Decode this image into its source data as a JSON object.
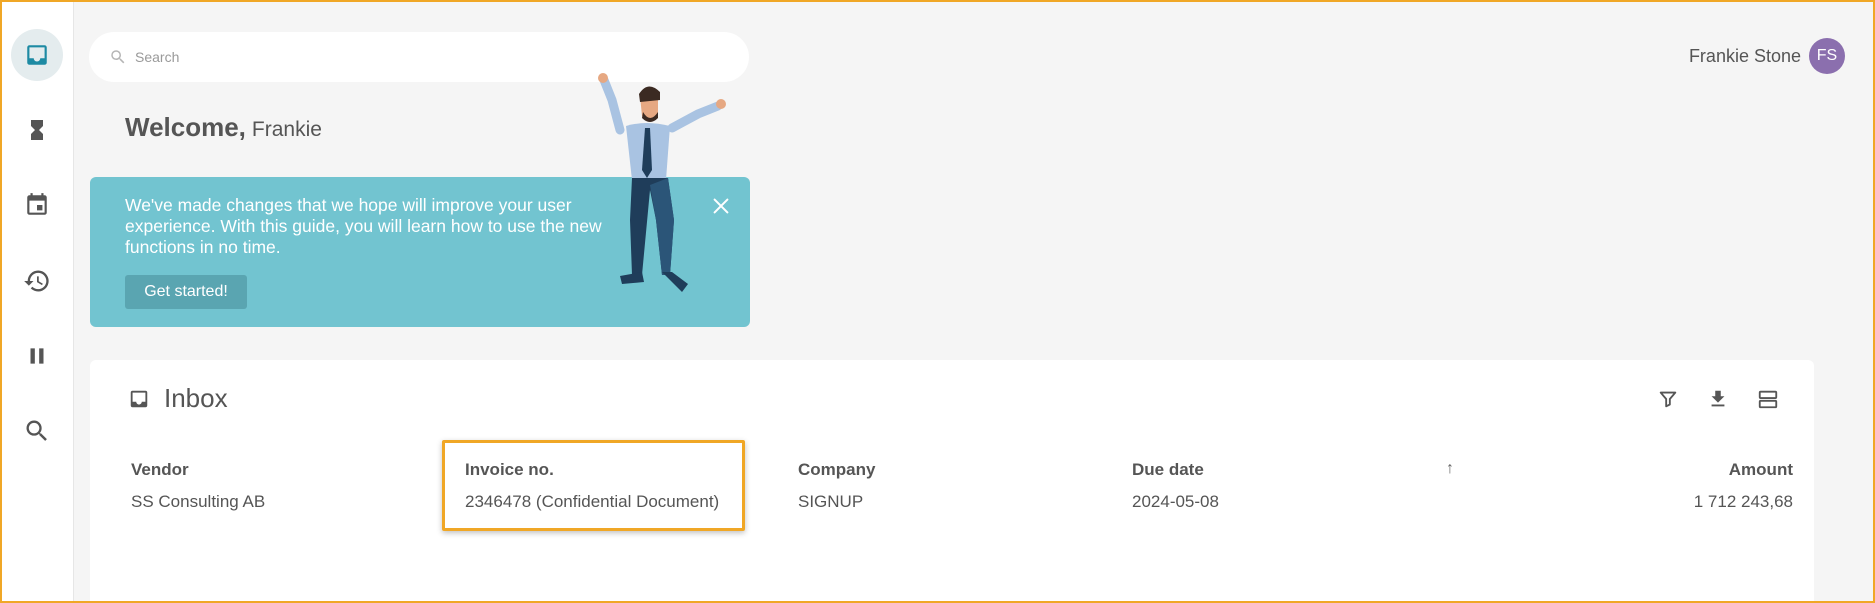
{
  "search": {
    "placeholder": "Search"
  },
  "user": {
    "name": "Frankie Stone",
    "initials": "FS",
    "avatar_color": "#8b6fae"
  },
  "welcome": {
    "greeting": "Welcome,",
    "name": "Frankie"
  },
  "banner": {
    "text": "We've made changes that we hope will improve your user experience. With this guide, you will learn how to use the new functions in no time.",
    "button_label": "Get started!",
    "background_color": "#72c4d0"
  },
  "sidebar": {
    "items": [
      {
        "icon": "inbox-icon",
        "active": true
      },
      {
        "icon": "hourglass-icon",
        "active": false
      },
      {
        "icon": "calendar-icon",
        "active": false
      },
      {
        "icon": "history-icon",
        "active": false
      },
      {
        "icon": "pause-icon",
        "active": false
      },
      {
        "icon": "search-icon",
        "active": false
      }
    ]
  },
  "inbox": {
    "title": "Inbox",
    "columns": [
      "Vendor",
      "Invoice no.",
      "Company",
      "Due date",
      "Amount"
    ],
    "sort_indicator": "↑",
    "rows": [
      {
        "vendor": "SS Consulting AB",
        "invoice_no": "2346478 (Confidential Document)",
        "company": "SIGNUP",
        "due_date": "2024-05-08",
        "amount": "1 712 243,68"
      }
    ],
    "tools": [
      "filter-icon",
      "download-icon",
      "view-toggle-icon"
    ]
  },
  "colors": {
    "accent": "#1d8aa3",
    "highlight": "#f0a726"
  }
}
